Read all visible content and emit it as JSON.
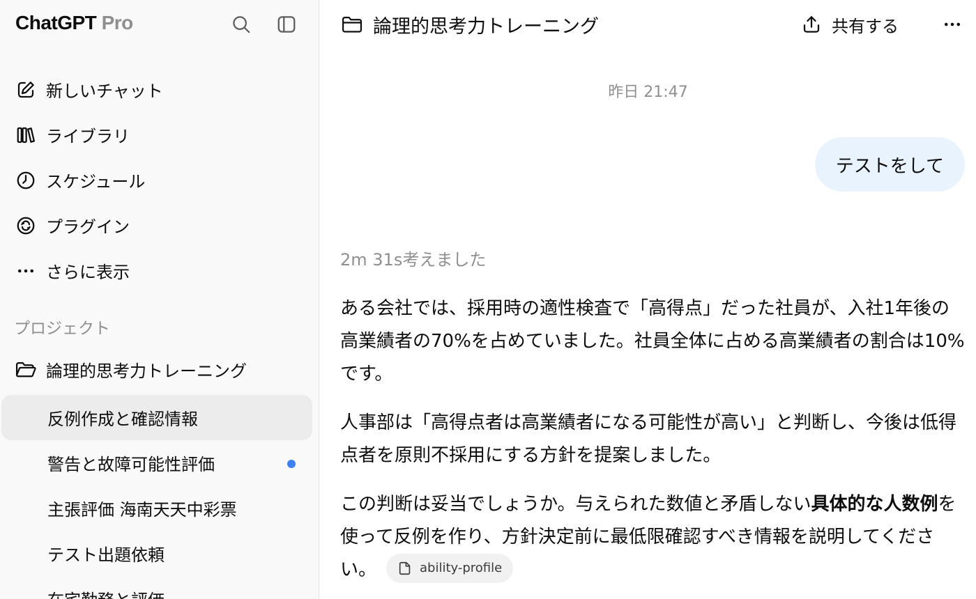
{
  "sidebar": {
    "brand": "ChatGPT",
    "brand_suffix": "Pro",
    "icons": {
      "search": "search-icon",
      "toggle": "sidebar-toggle-icon"
    },
    "nav": [
      {
        "label": "新しいチャット",
        "icon": "edit-icon"
      },
      {
        "label": "ライブラリ",
        "icon": "library-icon"
      },
      {
        "label": "スケジュール",
        "icon": "clock-icon"
      },
      {
        "label": "プラグイン",
        "icon": "plugin-icon"
      },
      {
        "label": "さらに表示",
        "icon": "more-horizontal-icon"
      }
    ],
    "section_label": "プロジェクト",
    "project": {
      "label": "論理的思考力トレーニング",
      "icon": "folder-open-icon"
    },
    "chats": [
      {
        "label": "反例作成と確認情報",
        "active": true,
        "unread": false
      },
      {
        "label": "警告と故障可能性評価",
        "active": false,
        "unread": true
      },
      {
        "label": "主張評価 海南天天中彩票",
        "active": false,
        "unread": false
      },
      {
        "label": "テスト出題依頼",
        "active": false,
        "unread": false
      },
      {
        "label": "在宅勤務と評価",
        "active": false,
        "unread": false
      }
    ],
    "unread_color": "#3b82f6"
  },
  "header": {
    "title": "論理的思考力トレーニング",
    "share_label": "共有する"
  },
  "conversation": {
    "timestamp": "昨日 21:47",
    "user_message": "テストをして",
    "thought_label": "2m 31s考えました",
    "answer": {
      "p1": "ある会社では、採用時の適性検査で「高得点」だった社員が、入社1年後の高業績者の70%を占めていました。社員全体に占める高業績者の割合は10%です。",
      "p2": "人事部は「高得点者は高業績者になる可能性が高い」と判断し、今後は低得点者を原則不採用にする方針を提案しました。",
      "p3_a": "この判断は妥当でしょうか。与えられた数値と矛盾しない",
      "p3_bold": "具体的な人数例",
      "p3_b": "を使って反例を作り、方針決定前に最低限確認すべき情報を説明してください。",
      "attachment": "ability-profile"
    }
  },
  "colors": {
    "user_bubble": "#e8f3fe",
    "active_chat": "#ececec",
    "muted_text": "#8f8f8f"
  }
}
